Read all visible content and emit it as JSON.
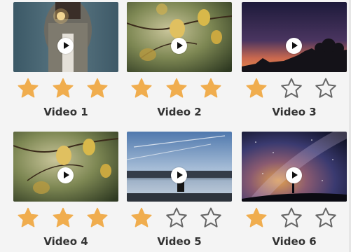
{
  "colors": {
    "star_filled": "#f0ad4e",
    "star_outline": "#666666",
    "label": "#333333"
  },
  "videos": [
    {
      "label": "Video 1",
      "rating": 3,
      "scene": "sparkler-icon"
    },
    {
      "label": "Video 2",
      "rating": 3,
      "scene": "autumn-leaves-icon"
    },
    {
      "label": "Video 3",
      "rating": 1,
      "scene": "sunset-trees-icon"
    },
    {
      "label": "Video 4",
      "rating": 3,
      "scene": "autumn-leaves-icon"
    },
    {
      "label": "Video 5",
      "rating": 1,
      "scene": "lake-figure-icon"
    },
    {
      "label": "Video 6",
      "rating": 1,
      "scene": "milky-way-icon"
    }
  ],
  "max_rating": 3
}
